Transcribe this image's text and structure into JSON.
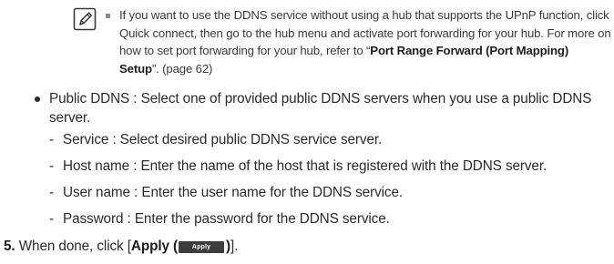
{
  "note": {
    "icon": "note-pencil-icon",
    "text_part1": "If you want to use the DDNS service without using a hub that supports the UPnP function, click Quick connect, then go to the hub menu and activate port forwarding for your hub. For more on how to set port forwarding for your hub, refer to “",
    "link_text": "Port Range Forward (Port Mapping) Setup",
    "text_part2": "”. (page 62)"
  },
  "public_ddns": {
    "text": "Public DDNS : Select one of provided public DDNS servers when you use a public DDNS server.",
    "items": [
      "Service : Select desired public DDNS service server.",
      "Host name : Enter the name of the host that is registered with the DDNS server.",
      "User name : Enter the user name for the DDNS service.",
      "Password : Enter the password for the DDNS service."
    ]
  },
  "step5": {
    "number": "5.",
    "text_before": " When done, click [",
    "bold_label": "Apply (",
    "button_label": "Apply",
    "bold_close": ")",
    "text_after": "]."
  }
}
